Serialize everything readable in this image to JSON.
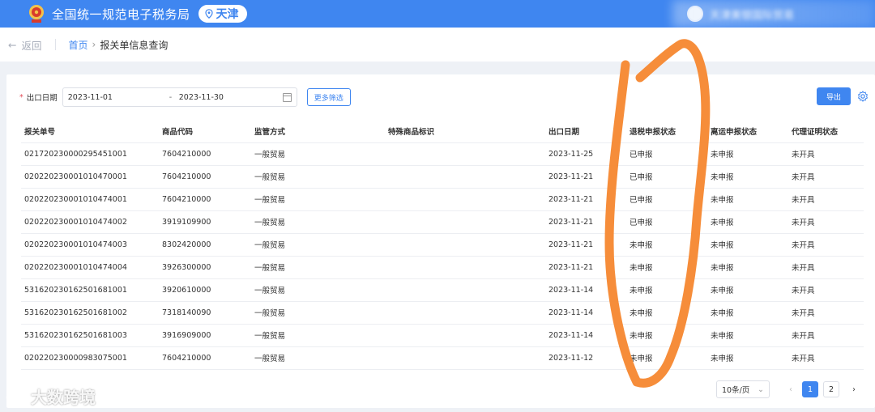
{
  "header": {
    "title": "全国统一规范电子税务局",
    "region": "天津",
    "user_name": "天津美银国际贸易"
  },
  "breadcrumb": {
    "back_label": "返回",
    "home": "首页",
    "current": "报关单信息查询"
  },
  "filters": {
    "date_label": "出口日期",
    "start_date": "2023-11-01",
    "separator": "-",
    "end_date": "2023-11-30",
    "more_filter_label": "更多筛选"
  },
  "toolbar": {
    "export_label": "导出"
  },
  "table": {
    "columns": [
      "报关单号",
      "商品代码",
      "监管方式",
      "特殊商品标识",
      "出口日期",
      "退税申报状态",
      "离运申报状态",
      "代理证明状态"
    ],
    "rows": [
      [
        "021720230000295451001",
        "7604210000",
        "一般贸易",
        "",
        "2023-11-25",
        "已申报",
        "未申报",
        "未开具"
      ],
      [
        "020220230001010470001",
        "7604210000",
        "一般贸易",
        "",
        "2023-11-21",
        "已申报",
        "未申报",
        "未开具"
      ],
      [
        "020220230001010474001",
        "7604210000",
        "一般贸易",
        "",
        "2023-11-21",
        "已申报",
        "未申报",
        "未开具"
      ],
      [
        "020220230001010474002",
        "3919109900",
        "一般贸易",
        "",
        "2023-11-21",
        "已申报",
        "未申报",
        "未开具"
      ],
      [
        "020220230001010474003",
        "8302420000",
        "一般贸易",
        "",
        "2023-11-21",
        "未申报",
        "未申报",
        "未开具"
      ],
      [
        "020220230001010474004",
        "3926300000",
        "一般贸易",
        "",
        "2023-11-21",
        "未申报",
        "未申报",
        "未开具"
      ],
      [
        "531620230162501681001",
        "3920610000",
        "一般贸易",
        "",
        "2023-11-14",
        "未申报",
        "未申报",
        "未开具"
      ],
      [
        "531620230162501681002",
        "7318140090",
        "一般贸易",
        "",
        "2023-11-14",
        "未申报",
        "未申报",
        "未开具"
      ],
      [
        "531620230162501681003",
        "3916909000",
        "一般贸易",
        "",
        "2023-11-14",
        "未申报",
        "未申报",
        "未开具"
      ],
      [
        "020220230000983075001",
        "7604210000",
        "一般贸易",
        "",
        "2023-11-12",
        "未申报",
        "未申报",
        "未开具"
      ]
    ]
  },
  "pagination": {
    "page_size": "10条/页",
    "pages": [
      "1",
      "2"
    ],
    "current_page": "1"
  },
  "watermark": {
    "text": "大数跨境"
  },
  "colors": {
    "primary": "#3f86f0",
    "annotation": "#f5872f"
  }
}
